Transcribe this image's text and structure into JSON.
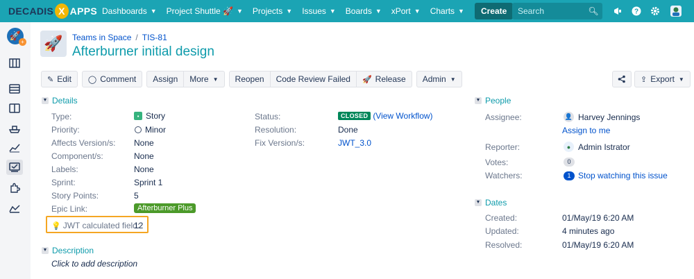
{
  "topbar": {
    "logo_left": "DECADIS",
    "logo_x": "X",
    "logo_right": "APPS",
    "nav": [
      {
        "label": "Dashboards",
        "icon": ""
      },
      {
        "label": "Project Shuttle",
        "icon": "🚀"
      },
      {
        "label": "Projects",
        "icon": ""
      },
      {
        "label": "Issues",
        "icon": ""
      },
      {
        "label": "Boards",
        "icon": ""
      },
      {
        "label": "xPort",
        "icon": ""
      },
      {
        "label": "Charts",
        "icon": ""
      }
    ],
    "create_label": "Create",
    "search_placeholder": "Search",
    "icons": [
      "megaphone-icon",
      "help-icon",
      "settings-icon",
      "user-avatar-icon"
    ]
  },
  "sidebar": {
    "items": [
      "project-avatar",
      "board-icon",
      "backlog-icon",
      "columns-icon",
      "ship-icon",
      "reports-icon",
      "issues-icon",
      "addons-icon",
      "charts-icon"
    ],
    "avatar_badge": "+"
  },
  "header": {
    "breadcrumb_project": "Teams in Space",
    "breadcrumb_sep": "/",
    "breadcrumb_issue": "TIS-81",
    "title": "Afterburner initial design"
  },
  "toolbar": {
    "edit": "Edit",
    "comment": "Comment",
    "assign": "Assign",
    "more": "More",
    "reopen": "Reopen",
    "code_review_failed": "Code Review Failed",
    "release": "Release",
    "admin": "Admin",
    "export": "Export"
  },
  "details": {
    "heading": "Details",
    "left": [
      {
        "label": "Type:",
        "value": "Story"
      },
      {
        "label": "Priority:",
        "value": "Minor"
      },
      {
        "label": "Affects Version/s:",
        "value": "None"
      },
      {
        "label": "Component/s:",
        "value": "None"
      },
      {
        "label": "Labels:",
        "value": "None"
      },
      {
        "label": "Sprint:",
        "value": "Sprint 1"
      },
      {
        "label": "Story Points:",
        "value": "5"
      },
      {
        "label": "Epic Link:",
        "value": "Afterburner Plus"
      },
      {
        "label": "JWT calculated field:",
        "value": "12"
      }
    ],
    "right": [
      {
        "label": "Status:",
        "value": "CLOSED",
        "extra": "(View Workflow)"
      },
      {
        "label": "Resolution:",
        "value": "Done"
      },
      {
        "label": "Fix Version/s:",
        "value": "JWT_3.0"
      }
    ]
  },
  "description": {
    "heading": "Description",
    "placeholder": "Click to add description"
  },
  "people": {
    "heading": "People",
    "assignee_label": "Assignee:",
    "assignee": "Harvey Jennings",
    "assign_to_me": "Assign to me",
    "reporter_label": "Reporter:",
    "reporter": "Admin Istrator",
    "votes_label": "Votes:",
    "votes": "0",
    "watchers_label": "Watchers:",
    "watchers": "1",
    "stop_watching": "Stop watching this issue"
  },
  "dates": {
    "heading": "Dates",
    "created_label": "Created:",
    "created": "01/May/19 6:20 AM",
    "updated_label": "Updated:",
    "updated": "4 minutes ago",
    "resolved_label": "Resolved:",
    "resolved": "01/May/19 6:20 AM"
  },
  "colors": {
    "topbar": "#1ba4b4",
    "title": "#0e9bab",
    "link": "#0052cc",
    "closed": "#00875a",
    "epic": "#4c9a2a",
    "highlight": "#f5a623"
  }
}
